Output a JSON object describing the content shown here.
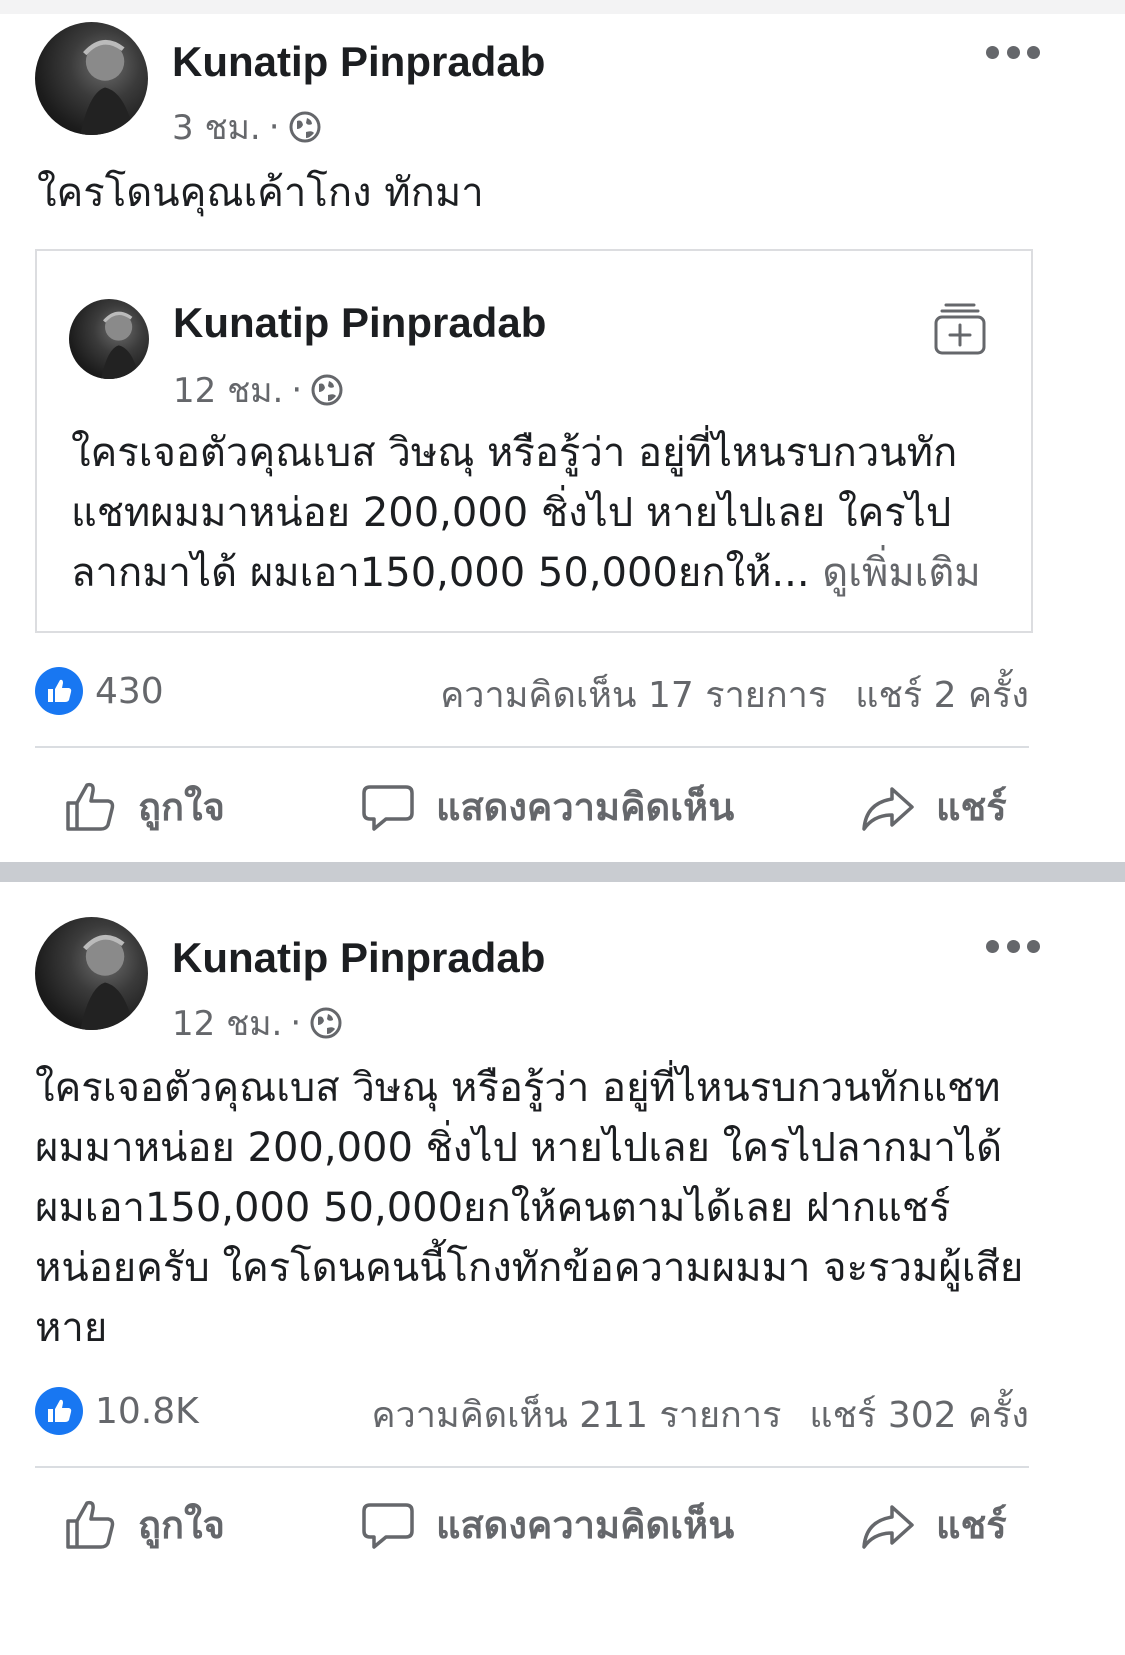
{
  "post1": {
    "author": "Kunatip Pinpradab",
    "time": "3 ชม.",
    "separator": "·",
    "privacy_icon": "globe-icon",
    "text": "ใครโดนคุณเค้าโกง ทักมา",
    "shared": {
      "author": "Kunatip Pinpradab",
      "time": "12 ชม.",
      "separator": "·",
      "privacy_icon": "globe-icon",
      "text": "ใครเจอตัวคุณเบส วิษณุ หรือรู้ว่า อยู่ที่ไหนรบกวนทักแชทผมมาหน่อย 200,000 ชิ่งไป หายไปเลย ใครไปลากมาได้ ผมเอา150,000 50,000ยกให้...",
      "see_more": "ดูเพิ่มเติม"
    },
    "likes": "430",
    "comments": "ความคิดเห็น 17 รายการ",
    "shares": "แชร์ 2 ครั้ง"
  },
  "post2": {
    "author": "Kunatip Pinpradab",
    "time": "12 ชม.",
    "separator": "·",
    "privacy_icon": "globe-icon",
    "text": "ใครเจอตัวคุณเบส วิษณุ หรือรู้ว่า อยู่ที่ไหนรบกวนทักแชทผมมาหน่อย 200,000 ชิ่งไป หายไปเลย ใครไปลากมาได้ผมเอา150,000 50,000ยกให้คนตามได้เลย ฝากแชร์หน่อยครับ ใครโดนคนนี้โกงทักข้อความผมมา จะรวมผู้เสียหาย",
    "likes": "10.8K",
    "comments": "ความคิดเห็น 211 รายการ",
    "shares": "แชร์ 302 ครั้ง"
  },
  "actions": {
    "like": "ถูกใจ",
    "comment": "แสดงความคิดเห็น",
    "share": "แชร์"
  },
  "colors": {
    "facebook_blue": "#1877f2",
    "secondary_text": "#65676b",
    "primary_text": "#1c1e21",
    "feed_separator": "#c9ccd1"
  }
}
